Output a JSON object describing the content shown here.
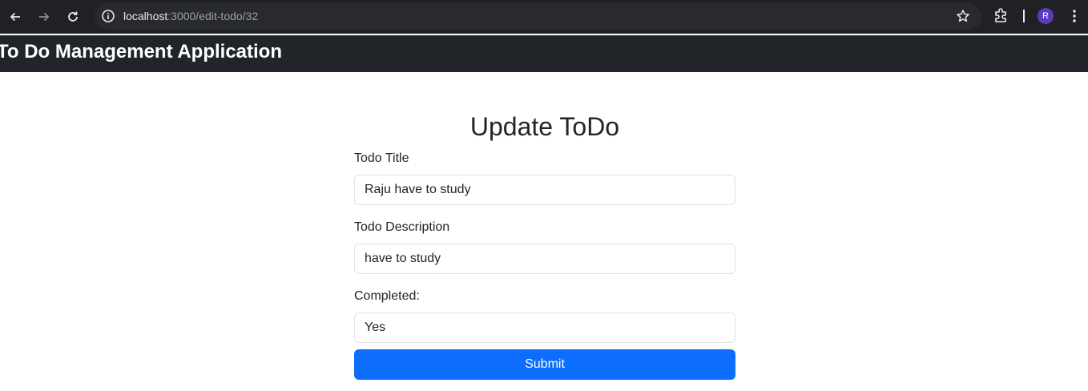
{
  "browser": {
    "url_host": "localhost",
    "url_path": ":3000/edit-todo/32",
    "avatar_letter": "R"
  },
  "app": {
    "brand": "To Do Management Application"
  },
  "form": {
    "title": "Update ToDo",
    "fields": [
      {
        "label": "Todo Title",
        "value": "Raju have to study"
      },
      {
        "label": "Todo Description",
        "value": "have to study"
      },
      {
        "label": "Completed:",
        "value": "Yes"
      }
    ],
    "submit_label": "Submit"
  },
  "colors": {
    "primary": "#0d6efd",
    "navbar": "#212529",
    "browser_chrome": "#202124"
  }
}
